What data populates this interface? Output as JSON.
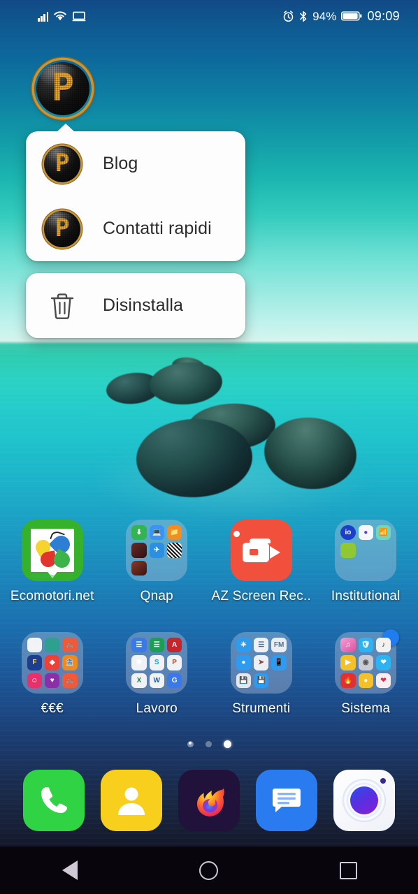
{
  "status_bar": {
    "signal_icon": "cellular-signal-icon",
    "wifi_icon": "wifi-icon",
    "cast_icon": "screen-cast-icon",
    "alarm_icon": "alarm-clock-icon",
    "bluetooth_icon": "bluetooth-icon",
    "battery_percent": "94%",
    "battery_icon": "battery-icon",
    "time": "09:09"
  },
  "pressed_app": {
    "name": "pressed-app-icon",
    "letter": "P"
  },
  "shortcut_popup": {
    "items": [
      {
        "label": "Blog",
        "icon": "app-shortcut-icon",
        "letter": "P"
      },
      {
        "label": "Contatti rapidi",
        "icon": "app-shortcut-icon",
        "letter": "P"
      }
    ],
    "uninstall": {
      "label": "Disinstalla",
      "icon": "trash-icon"
    }
  },
  "home_grid": {
    "rows": [
      [
        {
          "label": "Ecomotori.net",
          "type": "app",
          "icon": "ecomotori-icon"
        },
        {
          "label": "Qnap",
          "type": "folder",
          "icon": "folder-icon",
          "tiles": [
            "#34b352",
            "#3b93f2",
            "#ef8d27",
            "#5b2b22",
            "#2d8fe0",
            "#f2f2f2",
            "#6b2a2a",
            "",
            ""
          ]
        },
        {
          "label": "AZ Screen Rec..",
          "type": "app",
          "icon": "az-screen-recorder-icon"
        },
        {
          "label": "Institutional",
          "type": "folder",
          "icon": "folder-icon",
          "tiles": [
            "#1b3fc9",
            "#f6f7fb",
            "#6fd6c0",
            "#8fc832",
            "",
            "",
            "",
            "",
            ""
          ]
        }
      ],
      [
        {
          "label": "€€€",
          "type": "folder",
          "icon": "folder-icon",
          "tiles": [
            "#f2f3f5",
            "#2f9f90",
            "#ef5a3a",
            "#1f3d8f",
            "#ee4036",
            "#f08a20",
            "#e8306b",
            "#8b2fa8",
            "#ef5a3a"
          ]
        },
        {
          "label": "Lavoro",
          "type": "folder",
          "icon": "folder-icon",
          "tiles": [
            "#3b79e8",
            "#1e9e54",
            "#c8252a",
            "#f1f2f4",
            "#2a9fe0",
            "#d24726",
            "#1e7a45",
            "#1b5fb0",
            "#3b79e8"
          ]
        },
        {
          "label": "Strumenti",
          "type": "folder",
          "icon": "folder-icon",
          "tiles": [
            "#2d9bf0",
            "#eef2f6",
            "#e8eef4",
            "#2d9bf0",
            "#eceff4",
            "#2d9bf0",
            "#e4e8ee",
            "#2d9bf0",
            ""
          ]
        },
        {
          "label": "Sistema",
          "type": "folder",
          "icon": "folder-icon",
          "badge": true,
          "tiles": [
            "#e766b8",
            "#2db4f0",
            "#f2f2f2",
            "#f5c02a",
            "#c9ccd2",
            "#2db4f0",
            "#e03030",
            "#f5c02a",
            "#f6eef0"
          ]
        }
      ]
    ]
  },
  "page_indicator": {
    "pages": 3,
    "active_index": 2
  },
  "dock": {
    "items": [
      {
        "name": "phone-app",
        "icon": "phone-icon"
      },
      {
        "name": "contacts-app",
        "icon": "contacts-icon"
      },
      {
        "name": "firefox-app",
        "icon": "firefox-icon"
      },
      {
        "name": "messages-app",
        "icon": "messages-icon"
      },
      {
        "name": "camera-app",
        "icon": "camera-icon"
      }
    ]
  },
  "nav_bar": {
    "back": "back-nav-icon",
    "home": "home-nav-icon",
    "recents": "recents-nav-icon"
  },
  "colors": {
    "sky_top": "#124a86",
    "horizon": "#d6f3ec",
    "sea_top": "#2ec6a8",
    "sea_bottom": "#07080f",
    "popup_bg": "#fdfdfd",
    "accent_gold": "#e8a52c",
    "nav_bg": "#08060c"
  }
}
